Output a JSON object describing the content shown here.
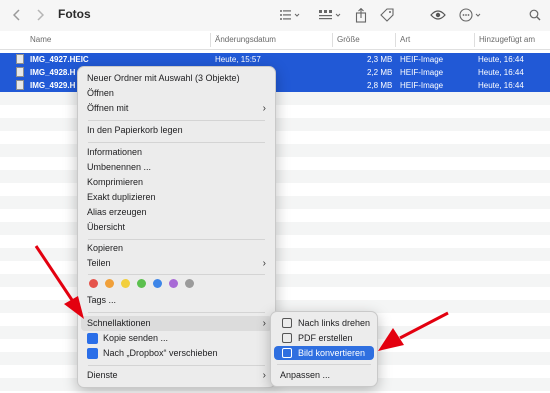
{
  "toolbar": {
    "back_icon": "chevron-left-icon",
    "forward_icon": "chevron-right-icon",
    "title": "Fotos",
    "icons": [
      "list-view-icon",
      "grid-view-icon",
      "share-icon",
      "tag-icon",
      "eye-icon",
      "more-icon",
      "search-icon"
    ]
  },
  "columns": {
    "name": "Name",
    "modified": "Änderungsdatum",
    "size": "Größe",
    "kind": "Art",
    "added": "Hinzugefügt am"
  },
  "files": [
    {
      "name": "IMG_4927.HEIC",
      "modified": "Heute, 15:57",
      "size": "2,3 MB",
      "kind": "HEIF-Image",
      "added": "Heute, 16:44"
    },
    {
      "name": "IMG_4928.H",
      "modified": "",
      "size": "2,2 MB",
      "kind": "HEIF-Image",
      "added": "Heute, 16:44"
    },
    {
      "name": "IMG_4929.H",
      "modified": "",
      "size": "2,8 MB",
      "kind": "HEIF-Image",
      "added": "Heute, 16:44"
    }
  ],
  "context_menu": {
    "new_folder": "Neuer Ordner mit Auswahl (3 Objekte)",
    "open": "Öffnen",
    "open_with": "Öffnen mit",
    "trash": "In den Papierkorb legen",
    "info": "Informationen",
    "rename": "Umbenennen ...",
    "compress": "Komprimieren",
    "duplicate": "Exakt duplizieren",
    "alias": "Alias erzeugen",
    "overview": "Übersicht",
    "copy": "Kopieren",
    "share": "Teilen",
    "tag_colors": [
      "#e5534b",
      "#f0a03a",
      "#f2cf3d",
      "#5cc04e",
      "#3e86e8",
      "#a86ad6",
      "#9b9b9b"
    ],
    "tags": "Tags ...",
    "quick_actions": "Schnellaktionen",
    "send_copy": "Kopie senden ...",
    "move_dropbox": "Nach „Dropbox“ verschieben",
    "services": "Dienste"
  },
  "submenu": {
    "rotate_left": "Nach links drehen",
    "create_pdf": "PDF erstellen",
    "convert_image": "Bild konvertieren",
    "customize": "Anpassen ..."
  },
  "colors": {
    "selection": "#2159d6",
    "highlight": "#2f6fe0",
    "annotation_arrow": "#e3000f",
    "dropbox": "#2a6ee8"
  }
}
